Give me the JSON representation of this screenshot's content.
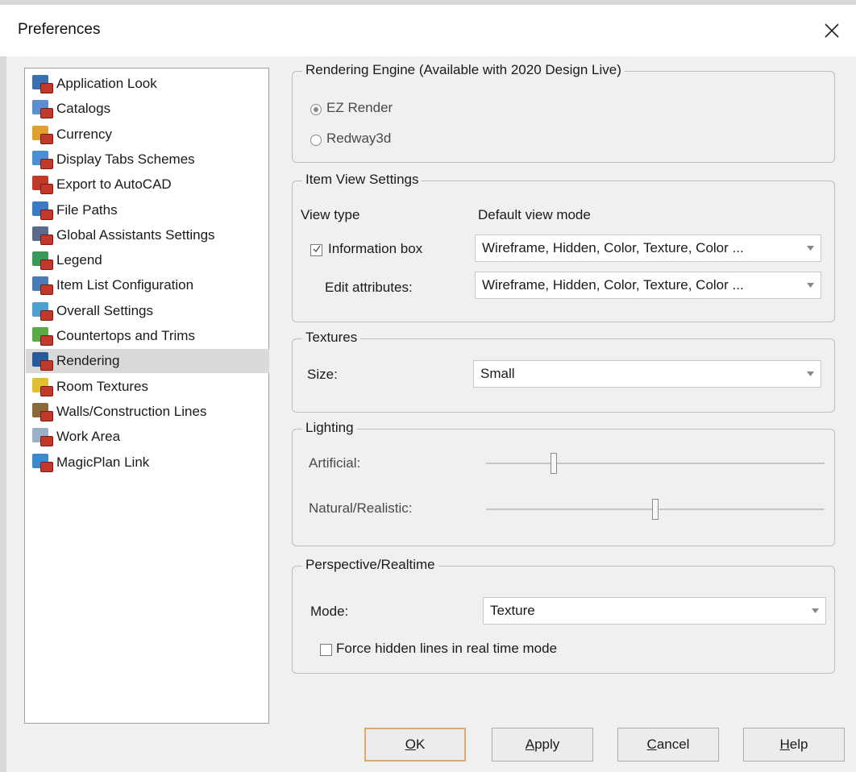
{
  "window": {
    "title": "Preferences"
  },
  "sidebar": {
    "selected_index": 11,
    "items": [
      {
        "label": "Application Look",
        "icon": "application-look-icon",
        "color": "#3a6fb0"
      },
      {
        "label": "Catalogs",
        "icon": "catalogs-icon",
        "color": "#5a8fd0"
      },
      {
        "label": "Currency",
        "icon": "currency-icon",
        "color": "#e0a030"
      },
      {
        "label": "Display Tabs Schemes",
        "icon": "display-tabs-icon",
        "color": "#4a90d9"
      },
      {
        "label": "Export to AutoCAD",
        "icon": "autocad-icon",
        "color": "#c0392b"
      },
      {
        "label": "File Paths",
        "icon": "file-paths-icon",
        "color": "#3a7bc8"
      },
      {
        "label": "Global Assistants Settings",
        "icon": "assistants-icon",
        "color": "#5a6a8a"
      },
      {
        "label": "Legend",
        "icon": "legend-icon",
        "color": "#3a9a5a"
      },
      {
        "label": "Item List Configuration",
        "icon": "item-list-icon",
        "color": "#4a7ab8"
      },
      {
        "label": "Overall Settings",
        "icon": "overall-settings-icon",
        "color": "#4aa0d0"
      },
      {
        "label": "Countertops and Trims",
        "icon": "countertops-icon",
        "color": "#5aaa4a"
      },
      {
        "label": "Rendering",
        "icon": "rendering-icon",
        "color": "#2a5a9a"
      },
      {
        "label": "Room Textures",
        "icon": "room-textures-icon",
        "color": "#e0c030"
      },
      {
        "label": "Walls/Construction Lines",
        "icon": "walls-icon",
        "color": "#8a6a3a"
      },
      {
        "label": "Work Area",
        "icon": "work-area-icon",
        "color": "#9ab0c8"
      },
      {
        "label": "MagicPlan Link",
        "icon": "magicplan-icon",
        "color": "#3a8ad0"
      }
    ]
  },
  "rendering_engine": {
    "title": "Rendering Engine (Available with 2020 Design Live)",
    "options": [
      {
        "label": "EZ Render",
        "checked": true
      },
      {
        "label": "Redway3d",
        "checked": false
      }
    ]
  },
  "item_view": {
    "title": "Item View Settings",
    "col_view_type": "View type",
    "col_default_mode": "Default view mode",
    "information_box": {
      "label": "Information box",
      "checked": true,
      "value": "Wireframe, Hidden, Color, Texture, Color ..."
    },
    "edit_attributes": {
      "label": "Edit attributes:",
      "value": "Wireframe, Hidden, Color, Texture, Color ..."
    }
  },
  "textures": {
    "title": "Textures",
    "size_label": "Size:",
    "size_value": "Small"
  },
  "lighting": {
    "title": "Lighting",
    "artificial_label": "Artificial:",
    "artificial_level": 0.2,
    "natural_label": "Natural/Realistic:",
    "natural_level": 0.5
  },
  "perspective": {
    "title": "Perspective/Realtime",
    "mode_label": "Mode:",
    "mode_value": "Texture",
    "force_hidden_label": "Force hidden lines in real time mode",
    "force_hidden_checked": false
  },
  "buttons": {
    "ok": {
      "accel": "O",
      "rest": "K"
    },
    "apply": {
      "accel": "A",
      "rest": "pply"
    },
    "cancel": {
      "accel": "C",
      "rest": "ancel"
    },
    "help": {
      "accel": "H",
      "rest": "elp"
    }
  }
}
